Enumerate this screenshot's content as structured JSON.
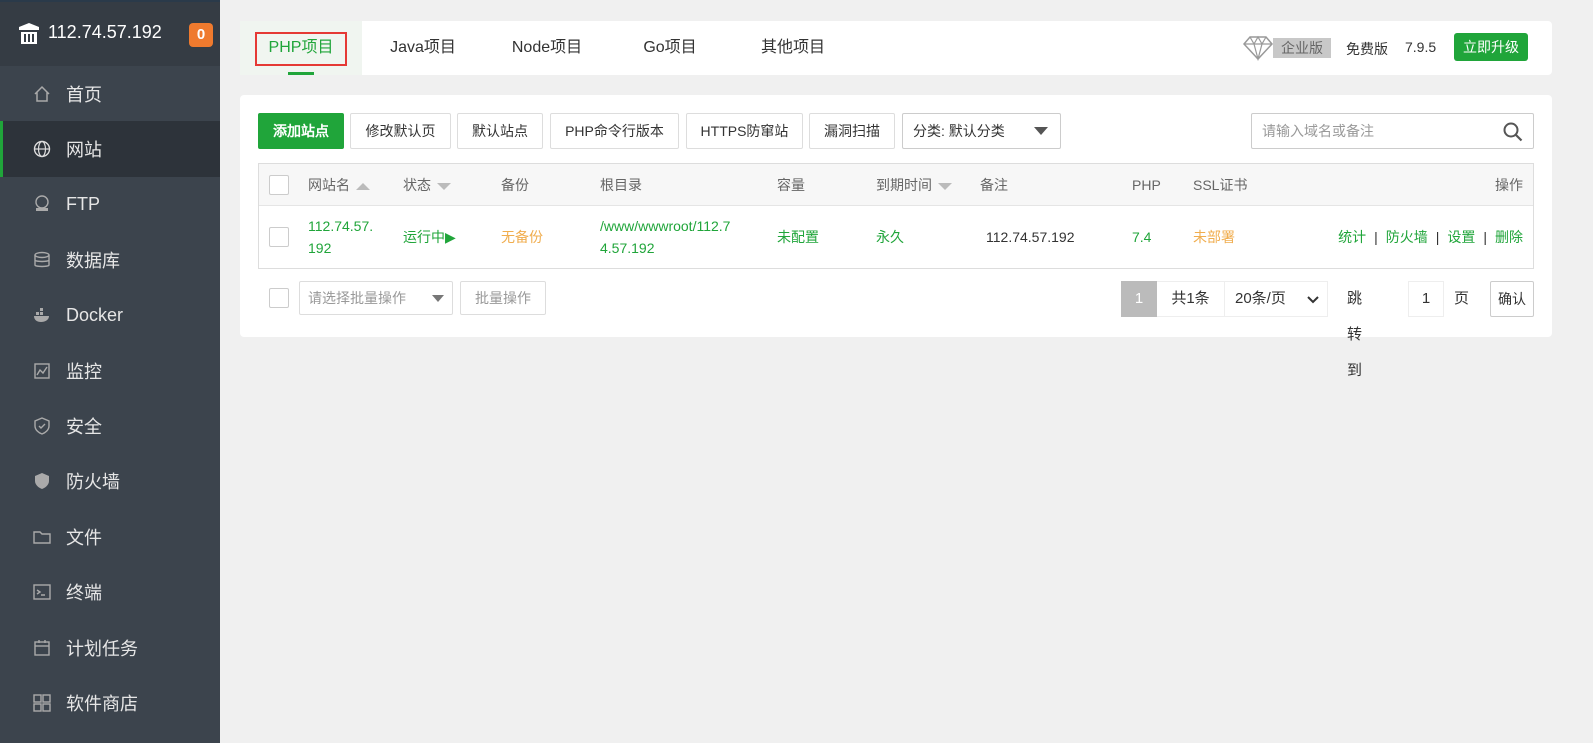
{
  "sidebar": {
    "server_ip": "112.74.57.192",
    "badge_count": "0",
    "items": [
      {
        "label": "首页",
        "icon": "home-icon"
      },
      {
        "label": "网站",
        "icon": "globe-icon"
      },
      {
        "label": "FTP",
        "icon": "ftp-icon"
      },
      {
        "label": "数据库",
        "icon": "database-icon"
      },
      {
        "label": "Docker",
        "icon": "docker-icon"
      },
      {
        "label": "监控",
        "icon": "monitor-icon"
      },
      {
        "label": "安全",
        "icon": "shield-icon"
      },
      {
        "label": "防火墙",
        "icon": "firewall-icon"
      },
      {
        "label": "文件",
        "icon": "folder-icon"
      },
      {
        "label": "终端",
        "icon": "terminal-icon"
      },
      {
        "label": "计划任务",
        "icon": "calendar-icon"
      },
      {
        "label": "软件商店",
        "icon": "apps-icon"
      }
    ],
    "active_index": 1
  },
  "topbar": {
    "tabs": [
      "PHP项目",
      "Java项目",
      "Node项目",
      "Go项目",
      "其他项目"
    ],
    "active_tab": 0,
    "enterprise_label": "企业版",
    "free_label": "免费版",
    "version": "7.9.5",
    "upgrade_label": "立即升级"
  },
  "toolbar": {
    "add_site": "添加站点",
    "modify_default_page": "修改默认页",
    "default_site": "默认站点",
    "php_cli_version": "PHP命令行版本",
    "https_guard": "HTTPS防窜站",
    "vuln_scan": "漏洞扫描",
    "category_select": "分类: 默认分类",
    "search_placeholder": "请输入域名或备注"
  },
  "table": {
    "headers": {
      "site_name": "网站名",
      "status": "状态",
      "backup": "备份",
      "root_dir": "根目录",
      "capacity": "容量",
      "expire": "到期时间",
      "remark": "备注",
      "php": "PHP",
      "ssl": "SSL证书",
      "actions": "操作"
    },
    "rows": [
      {
        "site_name_line1": "112.74.57.",
        "site_name_line2": "192",
        "status": "运行中▶",
        "backup": "无备份",
        "root_dir_line1": "/www/wwwroot/112.7",
        "root_dir_line2": "4.57.192",
        "capacity": "未配置",
        "expire": "永久",
        "remark": "112.74.57.192",
        "php": "7.4",
        "ssl": "未部署",
        "actions": [
          "统计",
          "防火墙",
          "设置",
          "删除"
        ]
      }
    ]
  },
  "footer": {
    "batch_select_placeholder": "请选择批量操作",
    "batch_button": "批量操作",
    "current_page": "1",
    "total": "共1条",
    "page_size": "20条/页",
    "jump_label": "跳转到",
    "jump_value": "1",
    "page_unit": "页",
    "confirm": "确认"
  },
  "colors": {
    "accent": "#20a53a",
    "sidebar_bg": "#3c444d",
    "warning": "#f0ad4e",
    "badge": "#ef7a2e"
  }
}
